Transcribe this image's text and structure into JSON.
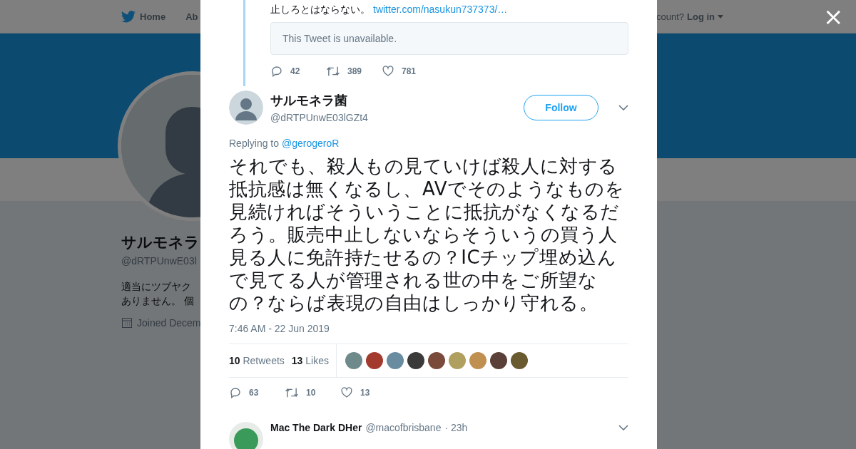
{
  "background_page": {
    "nav": {
      "home": "Home",
      "about": "Ab",
      "account_prompt": "count?",
      "login": "Log in"
    },
    "profile": {
      "name": "サルモネラ",
      "handle": "@dRTPUnwE03l",
      "bio_lines": [
        "適当にツブヤク",
        "ありません。 個"
      ],
      "joined": "Joined Decem"
    }
  },
  "dialog": {
    "close": "×",
    "quoted_reply": {
      "text_tail": "止しろとはならない。",
      "link": "twitter.com/nasukun737373/…",
      "unavailable": "This Tweet is unavailable.",
      "replies": "42",
      "retweets": "389",
      "likes": "781"
    },
    "tweet": {
      "name": "サルモネラ菌",
      "handle": "@dRTPUnwE03lGZt4",
      "follow": "Follow",
      "replying_label": "Replying to",
      "replying_to": "@gerogeroR",
      "text": "それでも、殺人もの見ていけば殺人に対する抵抗感は無くなるし、AVでそのようなものを見続ければそういうことに抵抗がなくなるだろう。販売中止しないならそういうの買う人見る人に免許持たせるの？ICチップ埋め込んで見てる人が管理される世の中をご所望なの？ならば表現の自由はしっかり守れる。",
      "time": "7:46 AM - 22 Jun 2019",
      "retweet_count": "10",
      "retweet_label": "Retweets",
      "like_count": "13",
      "like_label": "Likes",
      "likers": [
        {
          "color": "#6f8a8a"
        },
        {
          "color": "#a33a2e"
        },
        {
          "color": "#6a8ca0"
        },
        {
          "color": "#3a3a3a"
        },
        {
          "color": "#7a4a3a"
        },
        {
          "color": "#b0a060"
        },
        {
          "color": "#c09050"
        },
        {
          "color": "#5a4038"
        },
        {
          "color": "#6a5a30"
        }
      ],
      "replies": "63",
      "retweets": "10",
      "likes": "13"
    },
    "next_reply": {
      "name": "Mac The Dark DHer",
      "handle": "@macofbrisbane",
      "time": "· 23h"
    }
  }
}
